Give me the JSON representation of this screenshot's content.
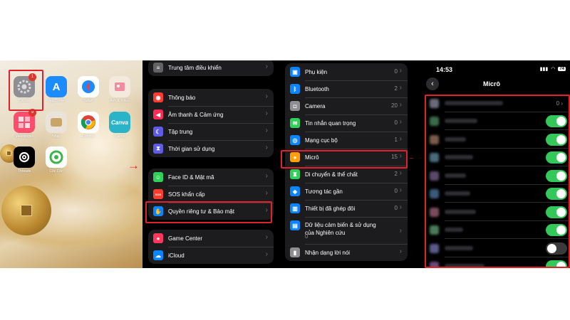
{
  "home": {
    "apps": [
      {
        "label": "Cài đặt",
        "icon": "gear-icon",
        "color": "#8e8e93",
        "badge": "1"
      },
      {
        "label": "App Store",
        "icon": "app-store-icon",
        "color": "#1a8cff"
      },
      {
        "label": "Safari",
        "icon": "compass-icon",
        "color": "#ffffff"
      },
      {
        "label": "Ảnh & Video",
        "icon": "photos-icon",
        "color": "#f4e9dd"
      },
      {
        "label": "Messenger",
        "icon": "messenger-icon",
        "color": "#ff4d6d",
        "badge": "9"
      },
      {
        "label": "Nhạc",
        "icon": "music-icon",
        "color": "#e9e3da"
      },
      {
        "label": "Chrome",
        "icon": "chrome-icon",
        "color": "#ffffff"
      },
      {
        "label": "Canva",
        "icon": "canva-icon",
        "color": "#2bb3c9",
        "text": "Canva"
      },
      {
        "label": "Threads",
        "icon": "threads-icon",
        "color": "#000000"
      },
      {
        "label": "Cốc Cốc",
        "icon": "coccoc-icon",
        "color": "#ffffff"
      }
    ]
  },
  "settings1": {
    "group1": [
      {
        "label": "Trung tâm điều khiển",
        "icon": "control-center-icon",
        "color": "#636366"
      }
    ],
    "group2": [
      {
        "label": "Thông báo",
        "icon": "bell-icon",
        "color": "#ff3b30"
      },
      {
        "label": "Âm thanh & Cảm ứng",
        "icon": "speaker-icon",
        "color": "#ff2d55"
      },
      {
        "label": "Tập trung",
        "icon": "moon-icon",
        "color": "#5e5ce6"
      },
      {
        "label": "Thời gian sử dụng",
        "icon": "hourglass-icon",
        "color": "#5e5ce6"
      }
    ],
    "group3": [
      {
        "label": "Face ID & Mật mã",
        "icon": "face-id-icon",
        "color": "#30d158"
      },
      {
        "label": "SOS khẩn cấp",
        "icon": "sos-icon",
        "color": "#ff3b30",
        "text": "SOS"
      },
      {
        "label": "Quyền riêng tư & Bảo mật",
        "icon": "hand-icon",
        "color": "#0a84ff"
      }
    ],
    "group4": [
      {
        "label": "Game Center",
        "icon": "game-center-icon",
        "color": "#ff375f"
      },
      {
        "label": "iCloud",
        "icon": "cloud-icon",
        "color": "#0a84ff"
      }
    ]
  },
  "settings2": {
    "rows": [
      {
        "label": "Phụ kiện",
        "count": "0",
        "icon": "accessory-icon",
        "color": "#0a84ff"
      },
      {
        "label": "Bluetooth",
        "count": "2",
        "icon": "bluetooth-icon",
        "color": "#0a84ff"
      },
      {
        "label": "Camera",
        "count": "20",
        "icon": "camera-icon",
        "color": "#8e8e93"
      },
      {
        "label": "Tin nhắn quan trọng",
        "count": "0",
        "icon": "message-icon",
        "color": "#30d158"
      },
      {
        "label": "Mạng cục bộ",
        "count": "1",
        "icon": "network-icon",
        "color": "#0a84ff"
      },
      {
        "label": "Micrô",
        "count": "15",
        "icon": "microphone-icon",
        "color": "#ff9f0a"
      },
      {
        "label": "Di chuyển & thể chất",
        "count": "2",
        "icon": "motion-icon",
        "color": "#30d158"
      },
      {
        "label": "Tương tác gần",
        "count": "0",
        "icon": "nearby-icon",
        "color": "#0a84ff"
      },
      {
        "label": "Thiết bị đã ghép đôi",
        "count": "0",
        "icon": "paired-device-icon",
        "color": "#0a84ff"
      },
      {
        "label": "Dữ liệu cảm biến & sử dụng của Nghiên cứu",
        "count": "0",
        "icon": "research-icon",
        "color": "#0a84ff"
      },
      {
        "label": "Nhận dạng lời nói",
        "count": "",
        "icon": "speech-icon",
        "color": "#8e8e93"
      }
    ]
  },
  "micro": {
    "time": "14:53",
    "battery": "74",
    "title": "Micrô",
    "first_value": "0",
    "toggles": [
      true,
      true,
      true,
      true,
      true,
      true,
      true,
      false,
      true,
      true
    ]
  }
}
